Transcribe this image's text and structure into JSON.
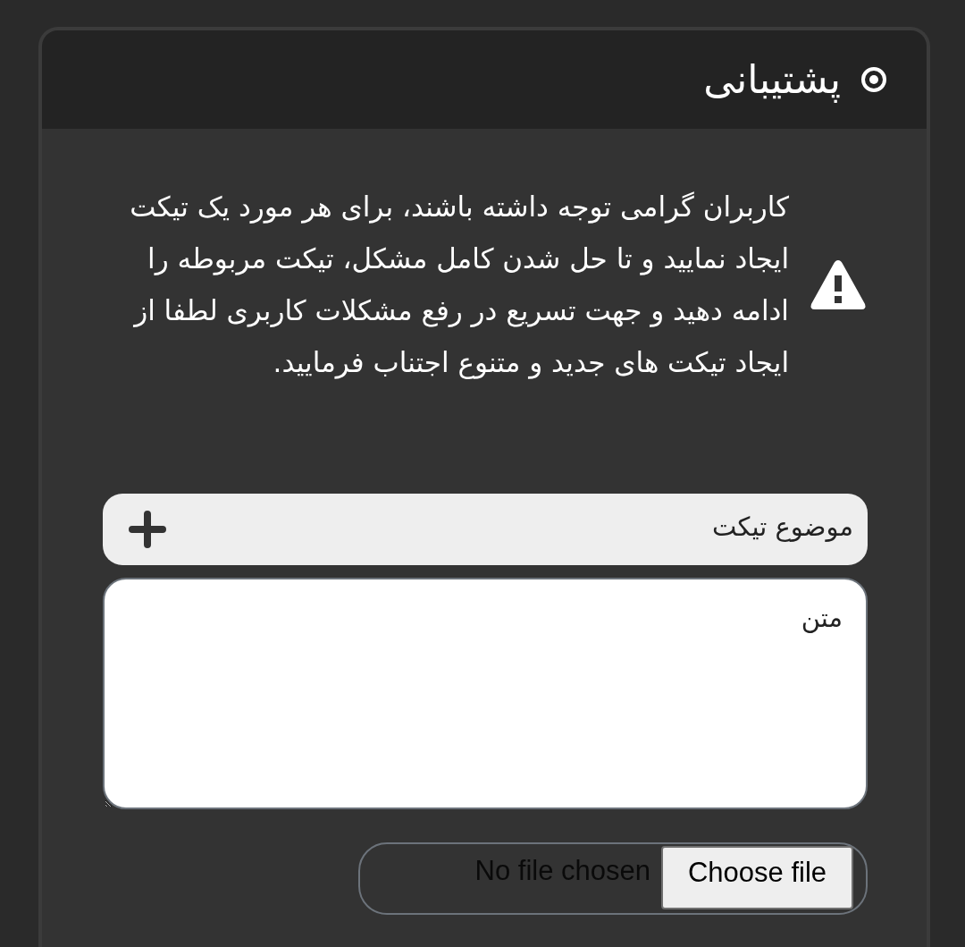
{
  "header": {
    "title": "پشتیبانی"
  },
  "notice": {
    "text": "کاربران گرامی توجه داشته باشند، برای هر مورد یک تیکت ایجاد نمایید و تا حل شدن کامل مشکل، تیکت مربوطه را ادامه دهید و جهت تسریع در رفع مشکلات کاربری لطفا از ایجاد تیکت های جدید و متنوع اجتناب فرمایید."
  },
  "form": {
    "subject": {
      "placeholder": "موضوع تیکت"
    },
    "message": {
      "placeholder": "متن"
    },
    "attachment": {
      "button": "Choose file",
      "status": "No file chosen"
    }
  }
}
